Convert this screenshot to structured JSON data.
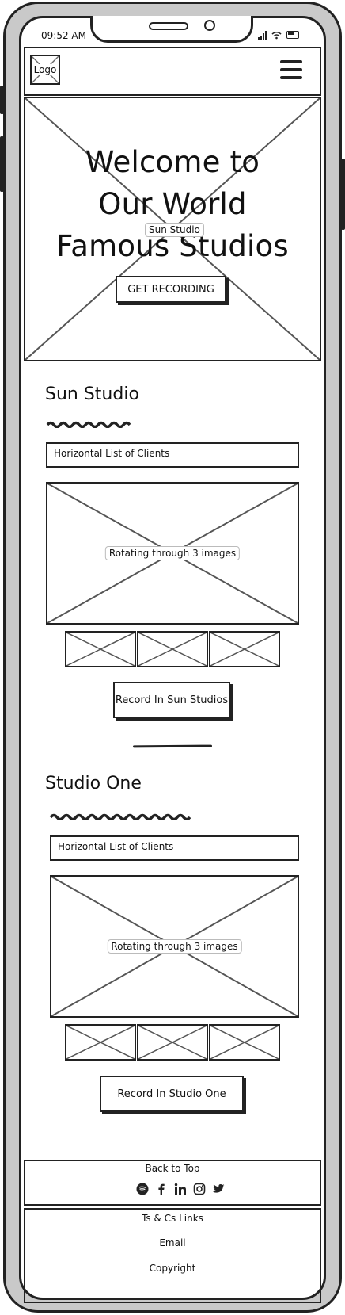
{
  "status_bar": {
    "time": "09:52 AM"
  },
  "header": {
    "logo": "Logo",
    "menu_icon": "hamburger-menu-icon"
  },
  "hero": {
    "title_lines": [
      "Welcome to",
      "Our World",
      "Famous Studios"
    ],
    "image_label": "Sun Studio",
    "cta": "GET RECORDING"
  },
  "studios": [
    {
      "title": "Sun Studio",
      "clients": "Horizontal List of Clients",
      "carousel_label": "Rotating through 3 images",
      "cta": "Record In Sun Studios"
    },
    {
      "title": "Studio One",
      "clients": "Horizontal List of Clients",
      "carousel_label": "Rotating through 3 images",
      "cta": "Record In Studio One"
    }
  ],
  "footer": {
    "back_to_top": "Back to Top",
    "social_icons": [
      "spotify-icon",
      "facebook-icon",
      "linkedin-icon",
      "instagram-icon",
      "twitter-icon"
    ],
    "links": [
      "Ts & Cs Links",
      "Email",
      "Copyright"
    ]
  },
  "colors": {
    "ink": "#222222",
    "frame": "#c9c9c9",
    "background": "#ffffff"
  }
}
